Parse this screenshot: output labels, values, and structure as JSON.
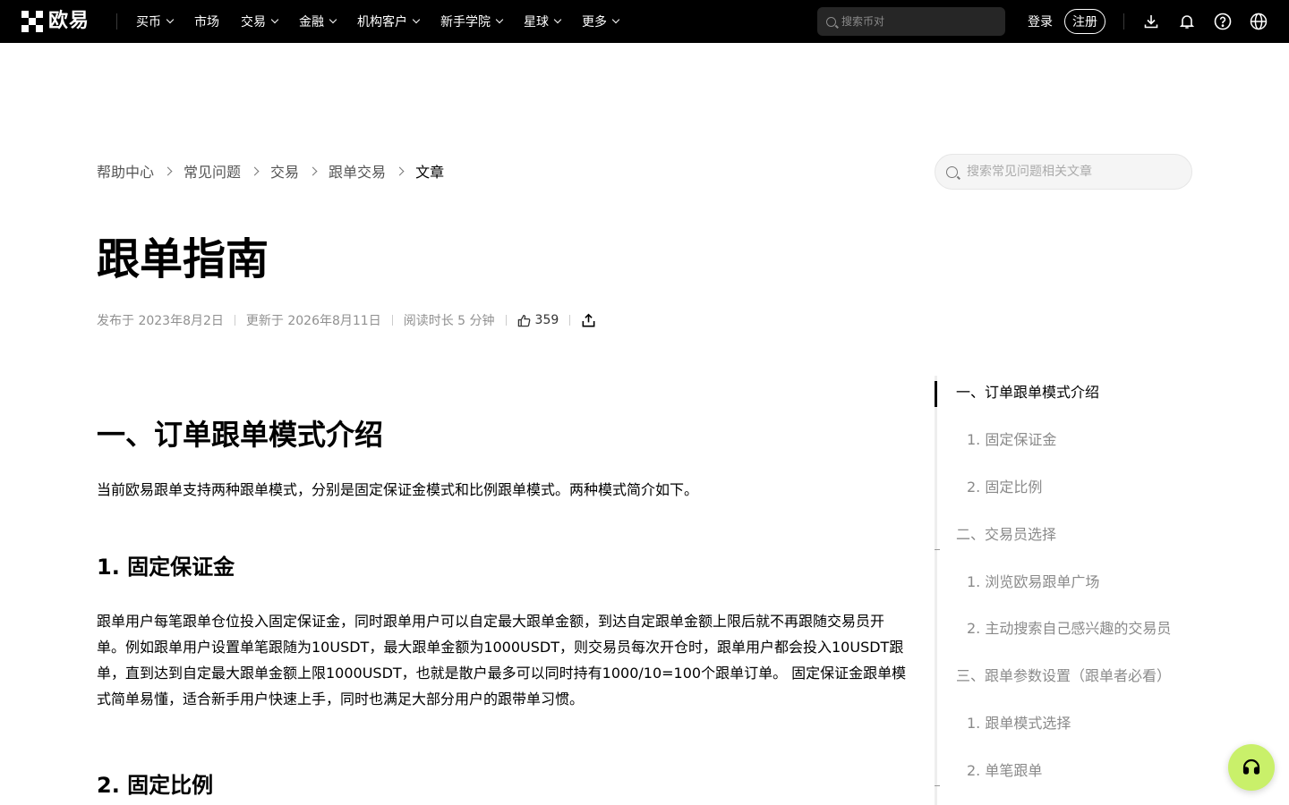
{
  "brand": {
    "name": "欧易"
  },
  "topnav": {
    "items": [
      {
        "label": "买币",
        "dropdown": true
      },
      {
        "label": "市场",
        "dropdown": false
      },
      {
        "label": "交易",
        "dropdown": true
      },
      {
        "label": "金融",
        "dropdown": true
      },
      {
        "label": "机构客户",
        "dropdown": true
      },
      {
        "label": "新手学院",
        "dropdown": true
      },
      {
        "label": "星球",
        "dropdown": true
      },
      {
        "label": "更多",
        "dropdown": true
      }
    ],
    "search_placeholder": "搜索币对",
    "login_label": "登录",
    "register_label": "注册",
    "icons": [
      "download-icon",
      "bell-icon",
      "help-icon",
      "globe-icon"
    ]
  },
  "breadcrumb": [
    "帮助中心",
    "常见问题",
    "交易",
    "跟单交易",
    "文章"
  ],
  "help_search": {
    "placeholder": "搜索常见问题相关文章"
  },
  "article": {
    "title": "跟单指南",
    "published": "发布于 2023年8月2日",
    "updated": "更新于 2026年8月11日",
    "read_time": "阅读时长 5 分钟",
    "likes": "359",
    "sections": {
      "s1_heading": "一、订单跟单模式介绍",
      "s1_intro": "当前欧易跟单支持两种跟单模式，分别是固定保证金模式和比例跟单模式。两种模式简介如下。",
      "s1_1_heading": "1. 固定保证金",
      "s1_1_body": "跟单用户每笔跟单仓位投入固定保证金，同时跟单用户可以自定最大跟单金额，到达自定跟单金额上限后就不再跟随交易员开单。例如跟单用户设置单笔跟随为10USDT，最大跟单金额为1000USDT，则交易员每次开仓时，跟单用户都会投入10USDT跟单，直到达到自定最大跟单金额上限1000USDT，也就是散户最多可以同时持有1000/10=100个跟单订单。 固定保证金跟单模式简单易懂，适合新手用户快速上手，同时也满足大部分用户的跟带单习惯。",
      "s1_2_heading": "2. 固定比例"
    }
  },
  "toc": [
    {
      "label": "一、订单跟单模式介绍",
      "level": 1,
      "active": true
    },
    {
      "label": "1. 固定保证金",
      "level": 2,
      "active": false
    },
    {
      "label": "2. 固定比例",
      "level": 2,
      "active": false
    },
    {
      "label": "二、交易员选择",
      "level": 1,
      "active": false
    },
    {
      "label": "1. 浏览欧易跟单广场",
      "level": 2,
      "active": false
    },
    {
      "label": "2. 主动搜索自己感兴趣的交易员",
      "level": 2,
      "active": false
    },
    {
      "label": "三、跟单参数设置（跟单者必看）",
      "level": 1,
      "active": false
    },
    {
      "label": "1. 跟单模式选择",
      "level": 2,
      "active": false
    },
    {
      "label": "2. 单笔跟单",
      "level": 2,
      "active": false
    }
  ],
  "colors": {
    "topbar": "#000000",
    "fab": "#c9f06a",
    "muted_text": "#8a8a8a"
  }
}
